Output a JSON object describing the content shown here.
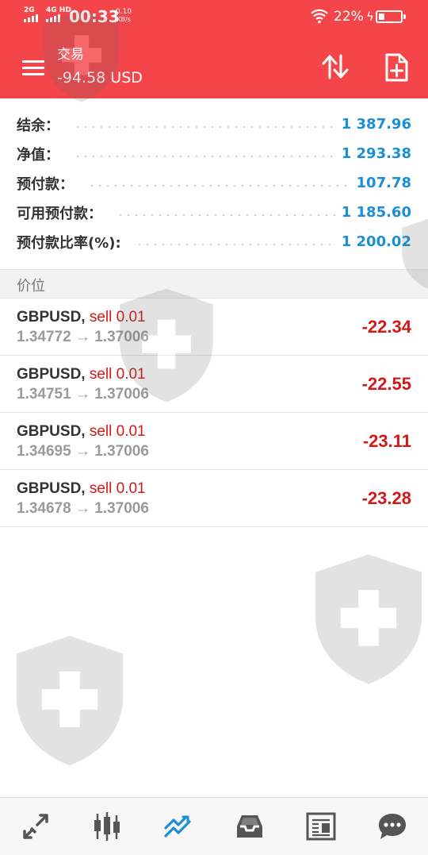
{
  "status_bar": {
    "network_1": "2G",
    "network_2": "4G HD",
    "time": "00:33",
    "speed_value": "0.10",
    "speed_unit": "KB/s",
    "battery_percent": "22%",
    "charging_glyph": "ϟ"
  },
  "app_bar": {
    "title": "交易",
    "subtitle": "-94.58 USD",
    "menu_icon": "hamburger-menu-icon",
    "sort_icon": "sort-arrows-icon",
    "new_order_icon": "new-order-icon"
  },
  "summary": [
    {
      "label": "结余：",
      "value": "1 387.96"
    },
    {
      "label": "净值：",
      "value": "1 293.38"
    },
    {
      "label": "预付款：",
      "value": "107.78"
    },
    {
      "label": "可用预付款：",
      "value": "1 185.60"
    },
    {
      "label": "预付款比率(%):",
      "value": "1 200.02"
    }
  ],
  "section_header": "价位",
  "positions": [
    {
      "symbol": "GBPUSD,",
      "side": "sell 0.01",
      "open": "1.34772",
      "arrow": "→",
      "current": "1.37006",
      "profit": "-22.34"
    },
    {
      "symbol": "GBPUSD,",
      "side": "sell 0.01",
      "open": "1.34751",
      "arrow": "→",
      "current": "1.37006",
      "profit": "-22.55"
    },
    {
      "symbol": "GBPUSD,",
      "side": "sell 0.01",
      "open": "1.34695",
      "arrow": "→",
      "current": "1.37006",
      "profit": "-23.11"
    },
    {
      "symbol": "GBPUSD,",
      "side": "sell 0.01",
      "open": "1.34678",
      "arrow": "→",
      "current": "1.37006",
      "profit": "-23.28"
    }
  ],
  "bottom_nav": [
    {
      "icon": "quotes-arrows-icon",
      "active": false
    },
    {
      "icon": "candlestick-chart-icon",
      "active": false
    },
    {
      "icon": "trade-trend-icon",
      "active": true
    },
    {
      "icon": "history-inbox-icon",
      "active": false
    },
    {
      "icon": "news-icon",
      "active": false
    },
    {
      "icon": "chat-icon",
      "active": false
    }
  ],
  "colors": {
    "header_bg": "#f4464a",
    "value_blue": "#1a8fd6",
    "loss_red": "#d21919",
    "active_nav": "#1a8fd6",
    "inactive_nav": "#555555"
  }
}
